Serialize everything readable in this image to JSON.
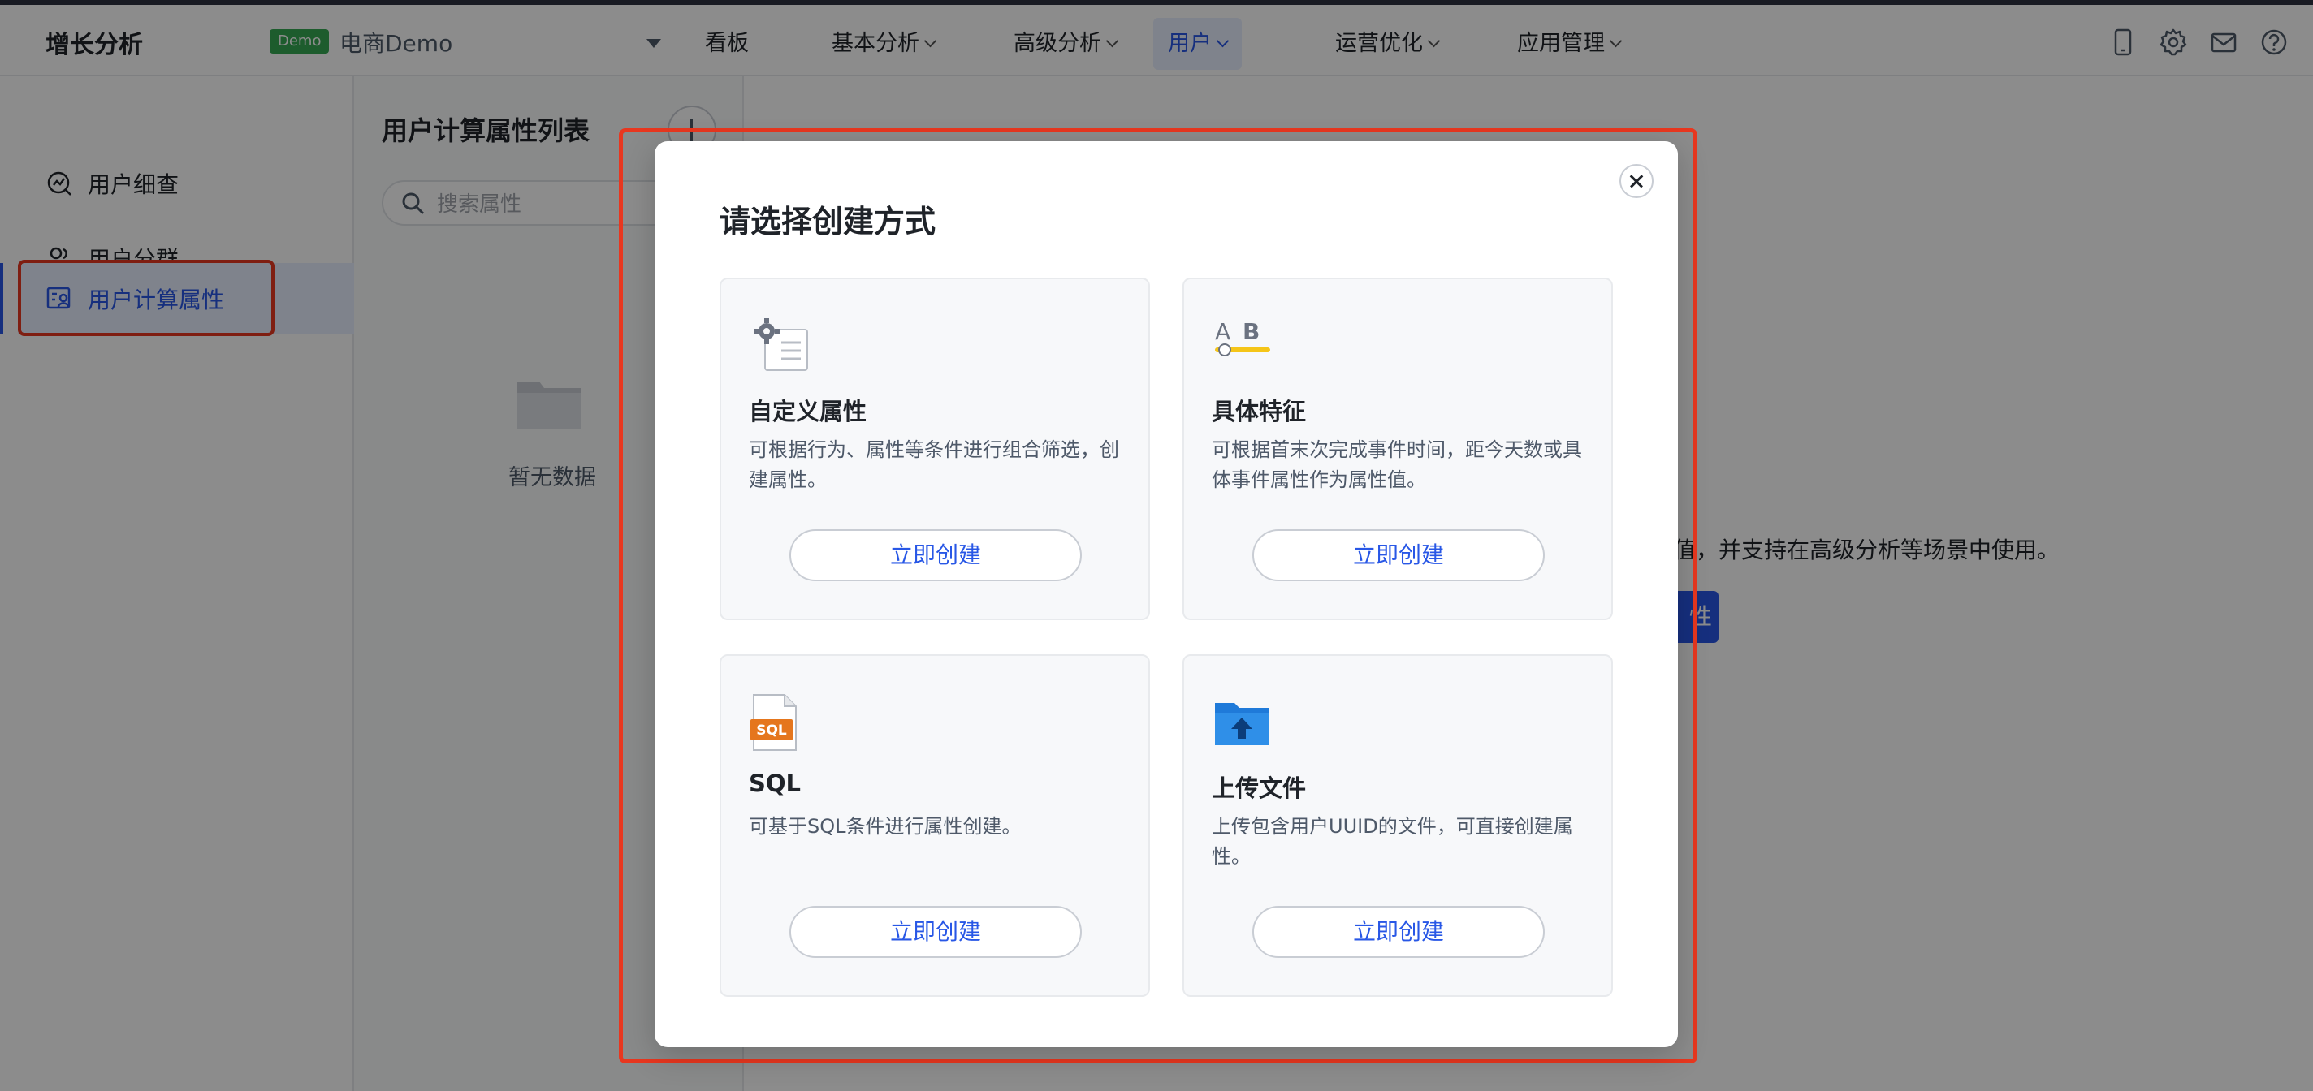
{
  "header": {
    "brand": "增长分析",
    "demo_badge": "Demo",
    "project": "电商Demo",
    "nav": [
      {
        "label": "看板",
        "has_menu": false
      },
      {
        "label": "基本分析",
        "has_menu": true
      },
      {
        "label": "高级分析",
        "has_menu": true
      },
      {
        "label": "用户",
        "has_menu": true,
        "active": true
      },
      {
        "label": "运营优化",
        "has_menu": true
      },
      {
        "label": "应用管理",
        "has_menu": true
      }
    ],
    "icons": [
      "mobile-icon",
      "gear-icon",
      "mail-icon",
      "help-icon"
    ]
  },
  "sidebar": {
    "items": [
      {
        "label": "用户细查",
        "icon": "user-lookup-icon"
      },
      {
        "label": "用户分群",
        "icon": "user-group-icon"
      },
      {
        "label": "用户计算属性",
        "icon": "user-attribute-icon",
        "active": true
      }
    ]
  },
  "list_panel": {
    "title": "用户计算属性列表",
    "search_placeholder": "搜索属性",
    "empty_text": "暂无数据"
  },
  "background": {
    "description_fragment": "值，并支持在高级分析等场景中使用。",
    "button_fragment": "性"
  },
  "modal": {
    "title": "请选择创建方式",
    "cards": [
      {
        "name": "自定义属性",
        "desc": "可根据行为、属性等条件进行组合筛选，创建属性。",
        "button": "立即创建",
        "icon": "custom-attribute-icon"
      },
      {
        "name": "具体特征",
        "desc": "可根据首末次完成事件时间，距今天数或具体事件属性作为属性值。",
        "button": "立即创建",
        "icon": "ab-feature-icon"
      },
      {
        "name": "SQL",
        "desc": "可基于SQL条件进行属性创建。",
        "button": "立即创建",
        "icon": "sql-file-icon",
        "icon_label": "SQL"
      },
      {
        "name": "上传文件",
        "desc": "上传包含用户UUID的文件，可直接创建属性。",
        "button": "立即创建",
        "icon": "upload-folder-icon"
      }
    ]
  },
  "colors": {
    "accent": "#2857e6",
    "highlight": "#e8371f",
    "badge": "#35a853",
    "icon_orange": "#e5761d",
    "icon_blue": "#2f8fe8",
    "icon_yellow": "#f5c518"
  }
}
